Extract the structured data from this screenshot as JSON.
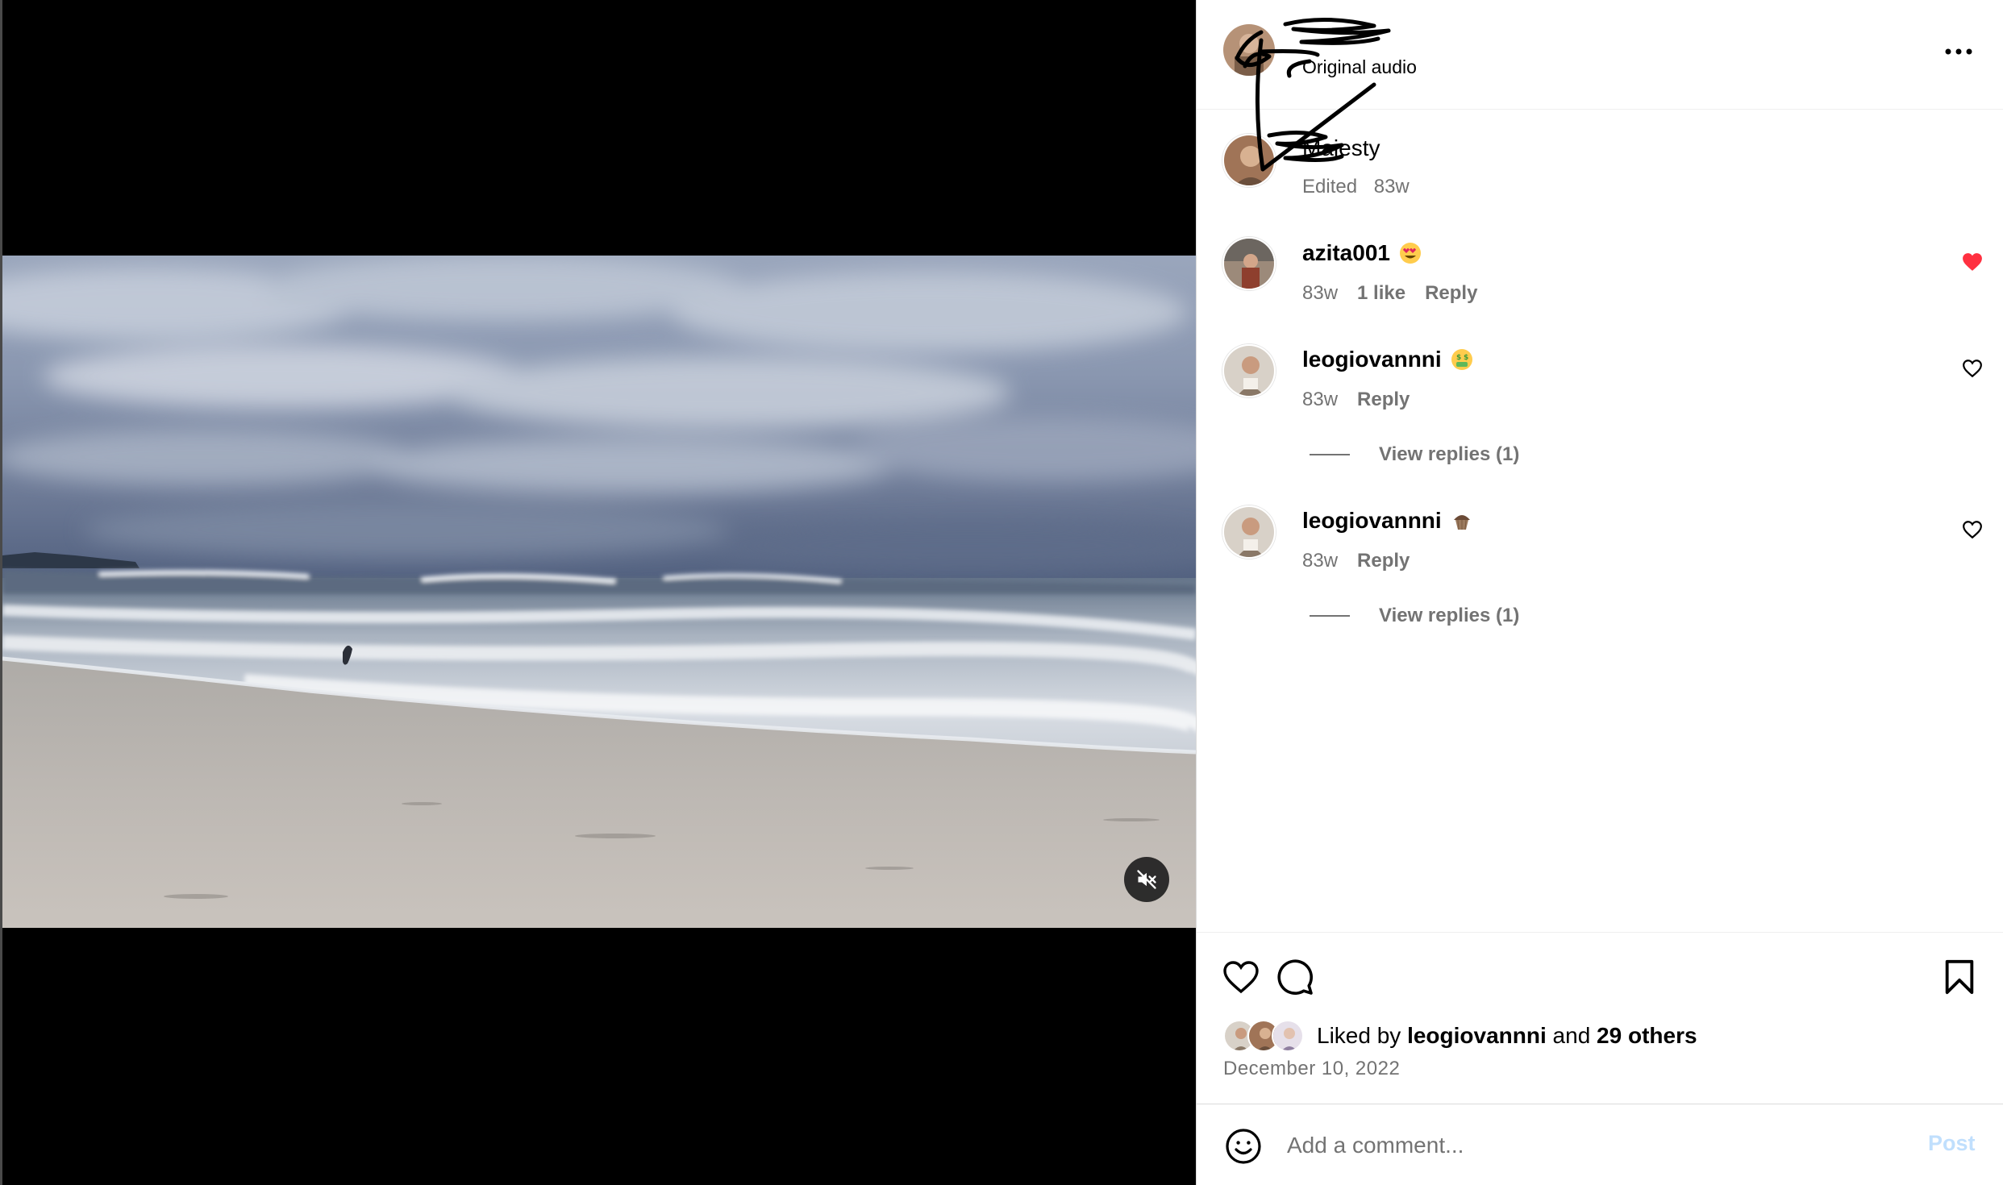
{
  "post": {
    "header": {
      "username": "",
      "audio_label": "Original audio",
      "more_icon": "more-horizontal-icon"
    },
    "caption": {
      "text": "Majesty",
      "edited_label": "Edited",
      "time": "83w"
    },
    "comments": [
      {
        "username": "azita001",
        "emoji": "heart-eyes",
        "time": "83w",
        "likes_label": "1 like",
        "reply_label": "Reply",
        "liked": true,
        "like_color": "#ff3040"
      },
      {
        "username": "leogiovannni",
        "emoji": "money-mouth",
        "time": "83w",
        "reply_label": "Reply",
        "liked": false,
        "view_replies_label": "View replies (1)"
      },
      {
        "username": "leogiovannni",
        "emoji": "cupcake",
        "time": "83w",
        "reply_label": "Reply",
        "liked": false,
        "view_replies_label": "View replies (1)"
      }
    ],
    "actions": {
      "like_icon": "heart-outline-icon",
      "comment_icon": "comment-bubble-icon",
      "save_icon": "bookmark-icon"
    },
    "likes": {
      "prefix": "Liked by",
      "user": "leogiovannni",
      "conjunction": "and",
      "others": "29 others"
    },
    "date": "December 10, 2022",
    "comment_input": {
      "placeholder": "Add a comment...",
      "post_label": "Post",
      "post_color": "#c0dffd"
    },
    "media": {
      "mute_icon": "muted-speaker-icon"
    }
  }
}
